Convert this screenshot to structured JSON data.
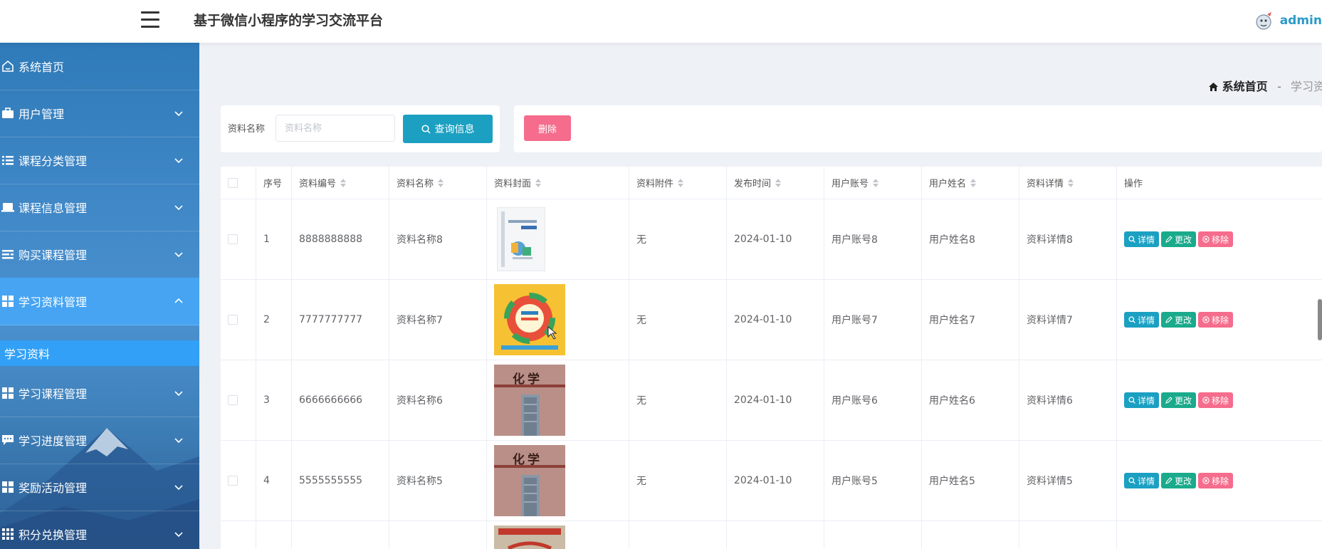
{
  "app": {
    "title": "基于微信小程序的学习交流平台",
    "user": "admin"
  },
  "sidebar": {
    "items": [
      {
        "label": "系统首页"
      },
      {
        "label": "用户管理"
      },
      {
        "label": "课程分类管理"
      },
      {
        "label": "课程信息管理"
      },
      {
        "label": "购买课程管理"
      },
      {
        "label": "学习资料管理"
      },
      {
        "label": "学习课程管理"
      },
      {
        "label": "学习进度管理"
      },
      {
        "label": "奖励活动管理"
      },
      {
        "label": "积分兑换管理"
      }
    ],
    "submenu": {
      "label": "学习资料"
    }
  },
  "breadcrumb": {
    "home": "系统首页",
    "separator": "-",
    "current": "学习资"
  },
  "search": {
    "label": "资料名称",
    "placeholder": "资料名称",
    "value": "",
    "button": "查询信息"
  },
  "actions": {
    "delete": "删除"
  },
  "table": {
    "headers": [
      "序号",
      "资料编号",
      "资料名称",
      "资料封面",
      "资料附件",
      "发布时间",
      "用户账号",
      "用户姓名",
      "资料详情",
      "操作"
    ],
    "op_labels": {
      "detail": "详情",
      "edit": "更改",
      "remove": "移除"
    },
    "rows": [
      {
        "no": "1",
        "code": "8888888888",
        "name": "资料名称8",
        "cover": "book-cover-light",
        "attachment": "无",
        "time": "2024-01-10",
        "account": "用户账号8",
        "username": "用户姓名8",
        "detail": "资料详情8"
      },
      {
        "no": "2",
        "code": "7777777777",
        "name": "资料名称7",
        "cover": "book-cover-yellow",
        "attachment": "无",
        "time": "2024-01-10",
        "account": "用户账号7",
        "username": "用户姓名7",
        "detail": "资料详情7"
      },
      {
        "no": "3",
        "code": "6666666666",
        "name": "资料名称6",
        "cover": "book-cover-chemistry",
        "cover_title": "化学",
        "attachment": "无",
        "time": "2024-01-10",
        "account": "用户账号6",
        "username": "用户姓名6",
        "detail": "资料详情6"
      },
      {
        "no": "4",
        "code": "5555555555",
        "name": "资料名称5",
        "cover": "book-cover-chemistry",
        "cover_title": "化学",
        "attachment": "无",
        "time": "2024-01-10",
        "account": "用户账号5",
        "username": "用户姓名5",
        "detail": "资料详情5"
      }
    ]
  },
  "colors": {
    "accent": "#1ba0c2",
    "edit": "#1aaa8c",
    "danger": "#f56c8c",
    "sidebar_active": "#46a4f2",
    "submenu": "#32a0f6"
  }
}
